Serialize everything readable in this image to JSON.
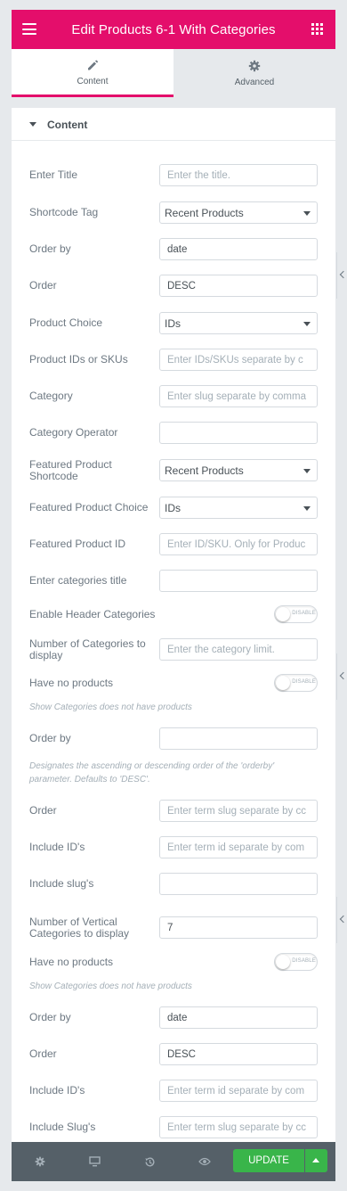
{
  "header": {
    "title": "Edit Products 6-1 With Categories",
    "menu_icon": "hamburger-icon",
    "apps_icon": "grid-icon",
    "color": "#e40e6b"
  },
  "tabs": [
    {
      "label": "Content",
      "icon": "pencil-icon",
      "active": true
    },
    {
      "label": "Advanced",
      "icon": "gear-icon",
      "active": false
    }
  ],
  "section": {
    "title": "Content"
  },
  "fields": {
    "enter_title": {
      "label": "Enter Title",
      "placeholder": "Enter the title."
    },
    "shortcode_tag": {
      "label": "Shortcode Tag",
      "value": "Recent Products"
    },
    "order_by_1": {
      "label": "Order by",
      "value": "date"
    },
    "order_1": {
      "label": "Order",
      "value": "DESC"
    },
    "product_choice": {
      "label": "Product Choice",
      "value": "IDs"
    },
    "product_ids": {
      "label": "Product IDs or SKUs",
      "placeholder": "Enter IDs/SKUs separate by c"
    },
    "category": {
      "label": "Category",
      "placeholder": "Enter slug separate by comma"
    },
    "category_operator": {
      "label": "Category Operator",
      "value": ""
    },
    "featured_shortcode": {
      "label": "Featured Product Shortcode",
      "value": "Recent Products"
    },
    "featured_choice": {
      "label": "Featured Product Choice",
      "value": "IDs"
    },
    "featured_id": {
      "label": "Featured Product ID",
      "placeholder": "Enter ID/SKU. Only for Produc"
    },
    "categories_title": {
      "label": "Enter categories title",
      "value": ""
    },
    "enable_header_categories": {
      "label": "Enable Header Categories",
      "state": "DISABLE"
    },
    "num_categories": {
      "label": "Number of Categories to display",
      "placeholder": "Enter the category limit."
    },
    "have_no_products_1": {
      "label": "Have no products",
      "state": "DISABLE",
      "description": "Show Categories does not have products"
    },
    "order_by_2": {
      "label": "Order by",
      "value": "",
      "description": "Designates the ascending or descending order of the 'orderby' parameter. Defaults to 'DESC'."
    },
    "order_2": {
      "label": "Order",
      "placeholder": "Enter term slug separate by cc"
    },
    "include_ids_1": {
      "label": "Include ID's",
      "placeholder": "Enter term id separate by com"
    },
    "include_slugs_1": {
      "label": "Include slug's",
      "value": ""
    },
    "num_vertical": {
      "label": "Number of Vertical Categories to display",
      "value": "7"
    },
    "have_no_products_2": {
      "label": "Have no products",
      "state": "DISABLE",
      "description": "Show Categories does not have products"
    },
    "order_by_3": {
      "label": "Order by",
      "value": "date"
    },
    "order_3": {
      "label": "Order",
      "value": "DESC"
    },
    "include_ids_2": {
      "label": "Include ID's",
      "placeholder": "Enter term id separate by com"
    },
    "include_slugs_2": {
      "label": "Include Slug's",
      "placeholder": "Enter term slug separate by cc"
    }
  },
  "footer": {
    "settings_icon": "gear-icon",
    "responsive_icon": "desktop-icon",
    "history_icon": "history-icon",
    "preview_icon": "eye-icon",
    "update_label": "UPDATE",
    "update_color": "#39b54a"
  }
}
